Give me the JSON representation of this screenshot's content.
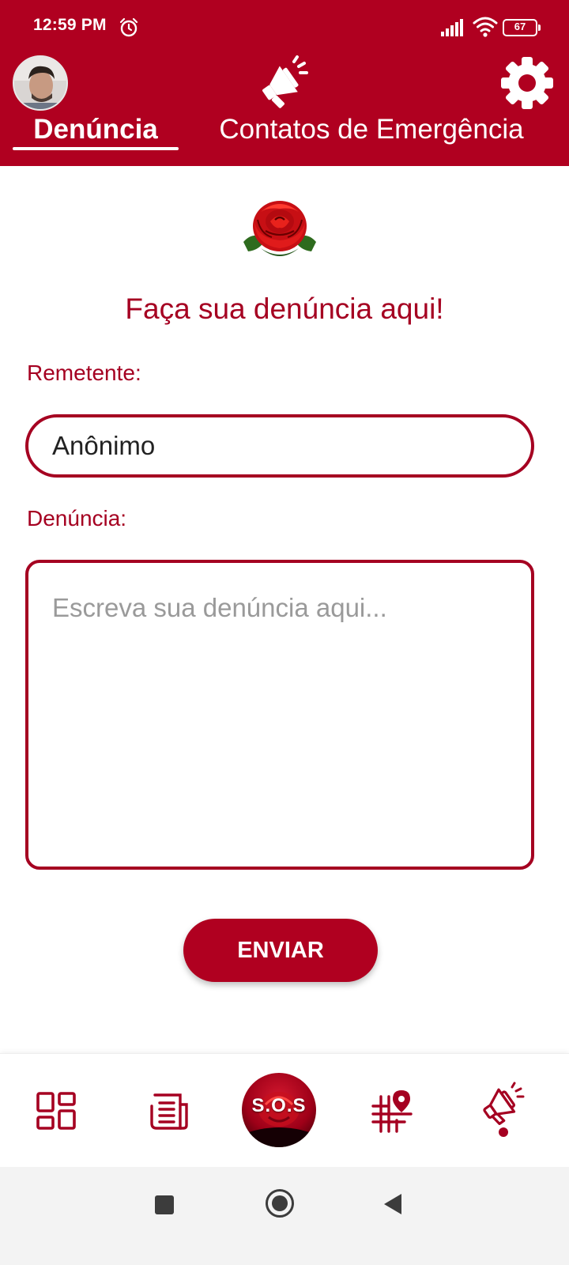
{
  "status_bar": {
    "time": "12:59 PM",
    "battery": "67",
    "icons": [
      "alarm-icon",
      "signal-icon",
      "wifi-icon",
      "battery-icon"
    ]
  },
  "header": {
    "tabs": [
      {
        "label": "Denúncia",
        "active": true
      },
      {
        "label": "Contatos de Emergência",
        "active": false
      }
    ],
    "icons": [
      "avatar",
      "megaphone-icon",
      "gear-icon"
    ]
  },
  "form": {
    "title": "Faça sua denúncia aqui!",
    "remetente_label": "Remetente:",
    "remetente_value": "Anônimo",
    "denuncia_label": "Denúncia:",
    "denuncia_placeholder": "Escreva sua denúncia aqui...",
    "submit_label": "ENVIAR"
  },
  "bottom_nav": {
    "sos_label": "S.O.S",
    "items": [
      "dashboard-icon",
      "news-icon",
      "sos-button",
      "map-icon",
      "megaphone-icon"
    ],
    "active_item": "megaphone-icon"
  },
  "colors": {
    "primary": "#b00020",
    "text_accent": "#a50021",
    "placeholder": "#9a9a9a"
  }
}
